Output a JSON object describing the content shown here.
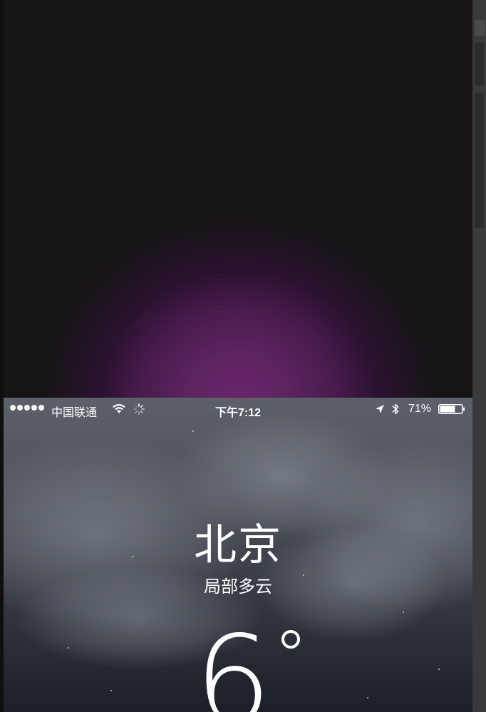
{
  "status_bar": {
    "signal_bars": 5,
    "carrier": "中国联通",
    "time": "下午7:12",
    "battery_percent": "71%",
    "battery_level": 0.71,
    "icons": [
      "wifi-icon",
      "activity-indicator-icon",
      "location-arrow-icon",
      "bluetooth-icon",
      "battery-icon"
    ]
  },
  "weather": {
    "city": "北京",
    "condition": "局部多云",
    "temperature": "6"
  },
  "colors": {
    "glow": "#6a2569",
    "background": "#141416",
    "sky_top": "#5b6069",
    "sky_bottom": "#1b1f27"
  }
}
